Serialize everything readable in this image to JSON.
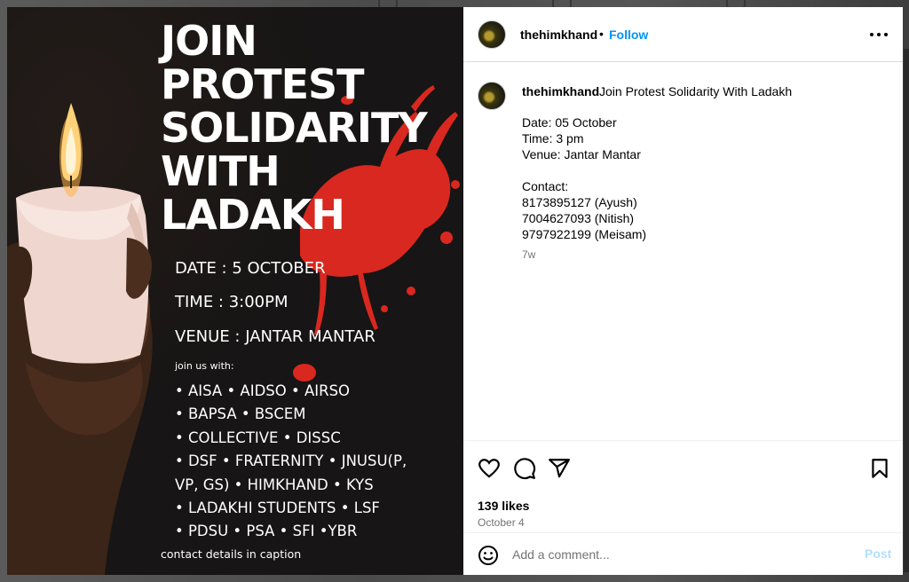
{
  "post_image": {
    "headline": "JOIN\nPROTEST\nSOLIDARITY\nWITH\nLADAKH",
    "date_line": "DATE : 5 OCTOBER",
    "time_line": "TIME : 3:00PM",
    "venue_line": "VENUE : JANTAR MANTAR",
    "join_with": "join us with:",
    "orgs": [
      "• AISA • AIDSO • AIRSO",
      "• BAPSA • BSCEM",
      "• COLLECTIVE • DISSC",
      "• DSF • FRATERNITY • JNUSU(P,",
      "VP, GS) • HIMKHAND • KYS",
      "• LADAKHI STUDENTS • LSF",
      "• PDSU • PSA • SFI •YBR"
    ],
    "contact_note": "contact details in caption",
    "colors": {
      "background": "#171515",
      "splash": "#d9281f",
      "candle": "#efd7cf",
      "flame": "#ffd27a"
    }
  },
  "header": {
    "username": "thehimkhand",
    "separator": "•",
    "follow_label": "Follow",
    "more_icon": "more-horizontal-icon"
  },
  "caption": {
    "username": "thehimkhand",
    "title": "Join Protest Solidarity With Ladakh",
    "lines": [
      "Date: 05 October",
      "Time: 3 pm",
      "Venue: Jantar Mantar",
      "",
      "Contact:",
      "8173895127 (Ayush)",
      "7004627093 (Nitish)",
      "9797922199 (Meisam)"
    ],
    "age": "7w"
  },
  "actions": {
    "icons": [
      "heart-icon",
      "comment-icon",
      "share-icon",
      "bookmark-icon"
    ],
    "likes": "139 likes",
    "date": "October 4"
  },
  "comment": {
    "placeholder": "Add a comment...",
    "post_label": "Post",
    "emoji_icon": "emoji-icon"
  },
  "theme": {
    "accent": "#0095f6",
    "post_disabled": "#b2dffc",
    "muted": "#737373",
    "border": "#dbdbdb"
  }
}
